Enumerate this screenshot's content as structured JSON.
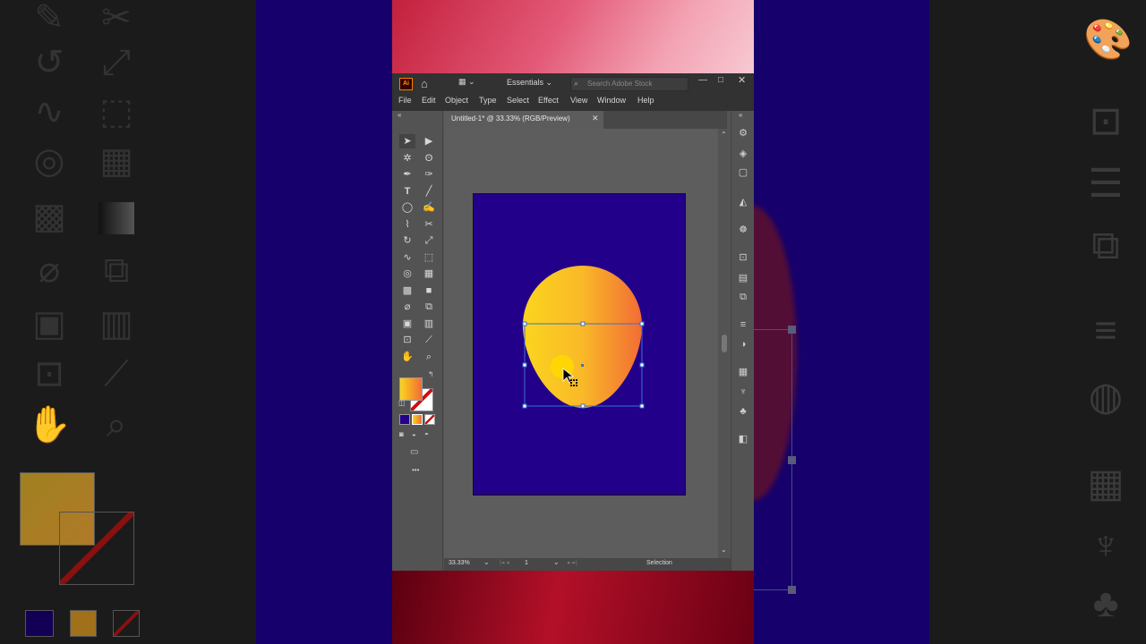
{
  "app": {
    "logo": "Ai",
    "workspace": "Essentials",
    "search_placeholder": "Search Adobe Stock",
    "menus": [
      "File",
      "Edit",
      "Object",
      "Type",
      "Select",
      "Effect",
      "View",
      "Window",
      "Help"
    ],
    "document_tab": "Untitled-1* @ 33.33% (RGB/Preview)",
    "zoom": "33.33%",
    "artboard_number": "1",
    "status_tool": "Selection",
    "more_tools": "•••"
  },
  "colors": {
    "artboard": "#22008a",
    "shape_gradient_start": "#fbd51e",
    "shape_gradient_end": "#f26c35",
    "ui_dark": "#323232",
    "ui_mid": "#535353",
    "selection_blue": "#3c6fd1"
  },
  "icons": {
    "tools": [
      "selection-tool",
      "direct-selection-tool",
      "magic-wand-tool",
      "lasso-tool",
      "pen-tool",
      "curvature-tool",
      "type-tool",
      "line-tool",
      "ellipse-tool",
      "paintbrush-tool",
      "shaper-tool",
      "scissors-tool",
      "rotate-tool",
      "scale-tool",
      "warp-tool",
      "free-transform-tool",
      "shape-builder-tool",
      "perspective-grid-tool",
      "mesh-tool",
      "gradient-tool",
      "eyedropper-tool",
      "blend-tool",
      "symbol-sprayer-tool",
      "column-graph-tool",
      "artboard-tool",
      "slice-tool",
      "hand-tool",
      "zoom-tool"
    ],
    "panels": [
      "properties",
      "layers",
      "libraries",
      "color-guide",
      "appearance",
      "transform",
      "align",
      "pathfinder",
      "stroke",
      "gradient",
      "swatches",
      "brushes",
      "symbols",
      "transparency"
    ]
  }
}
